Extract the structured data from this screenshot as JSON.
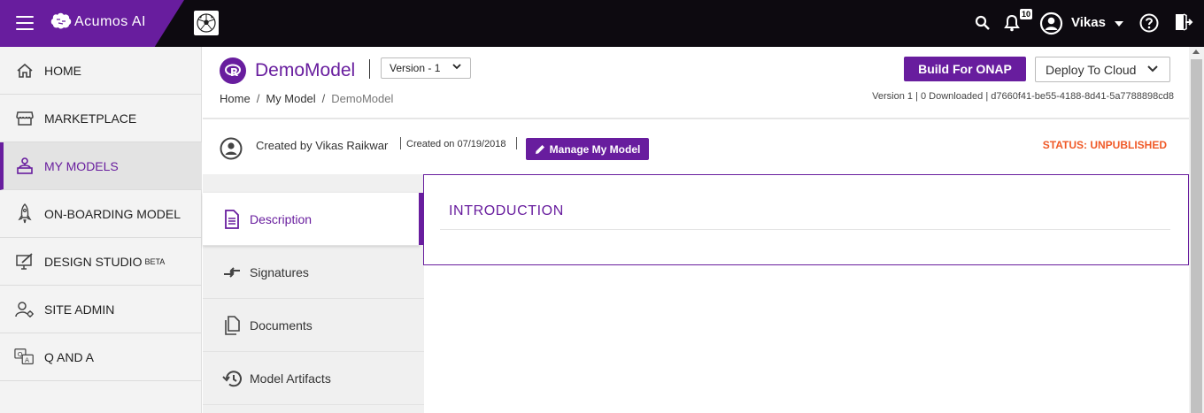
{
  "app": {
    "brand": "Acumos AI",
    "user_name": "Vikas",
    "notification_count": "10",
    "icons": [
      "menu-icon",
      "brain-logo-icon",
      "soccer-ball-icon",
      "search-icon",
      "bell-icon",
      "user-icon",
      "caret-down-icon",
      "help-icon",
      "logout-icon"
    ]
  },
  "sidebar": {
    "items": [
      {
        "label": "HOME",
        "icon": "home-icon"
      },
      {
        "label": "MARKETPLACE",
        "icon": "store-icon"
      },
      {
        "label": "MY MODELS",
        "icon": "models-icon",
        "active": true
      },
      {
        "label": "ON-BOARDING MODEL",
        "icon": "rocket-icon"
      },
      {
        "label": "DESIGN STUDIO",
        "sup": "BETA",
        "icon": "design-icon"
      },
      {
        "label": "SITE ADMIN",
        "icon": "admin-icon"
      },
      {
        "label": "Q AND A",
        "icon": "qa-icon"
      }
    ]
  },
  "model": {
    "name": "DemoModel",
    "version_selected": "Version - 1",
    "breadcrumb": [
      "Home",
      "My Model",
      "DemoModel"
    ],
    "build_button": "Build For ONAP",
    "deploy_button": "Deploy To Cloud",
    "meta": "Version 1 | 0 Downloaded | d7660f41-be55-4188-8d41-5a7788898cd8",
    "created_by": "Created by Vikas Raikwar",
    "created_on": "Created on 07/19/2018",
    "manage_button": "Manage My Model",
    "status": "STATUS: UNPUBLISHED"
  },
  "tabs": [
    {
      "label": "Description",
      "icon": "document-icon",
      "active": true
    },
    {
      "label": "Signatures",
      "icon": "signature-icon"
    },
    {
      "label": "Documents",
      "icon": "documents-icon"
    },
    {
      "label": "Model Artifacts",
      "icon": "history-icon"
    }
  ],
  "content": {
    "section_title": "INTRODUCTION"
  },
  "colors": {
    "accent": "#681d9e",
    "topbar": "#0d0a10",
    "status": "#f05a28"
  }
}
